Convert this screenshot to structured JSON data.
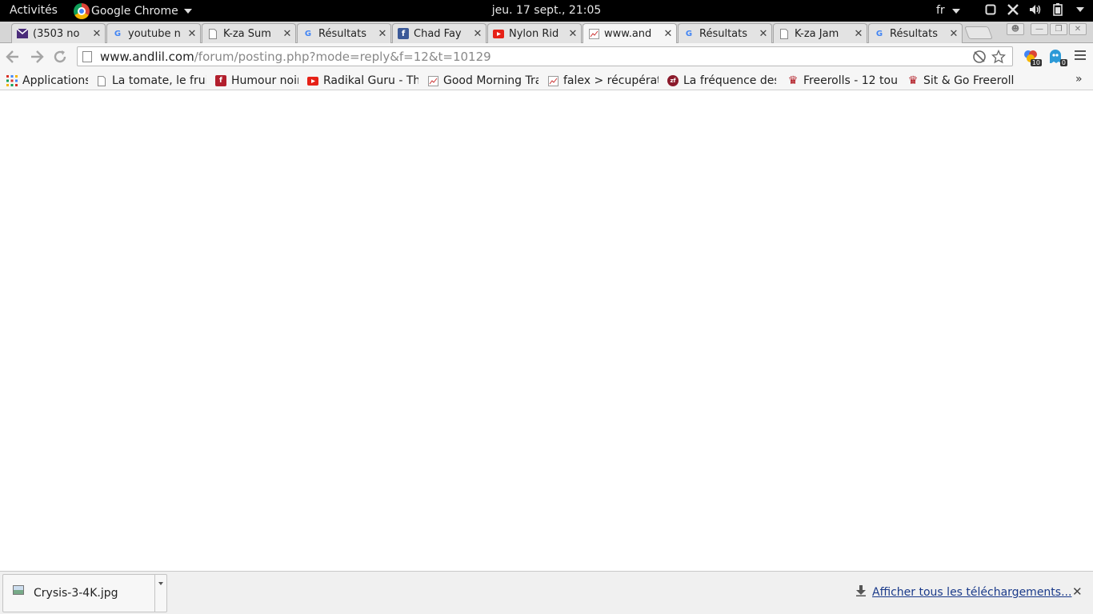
{
  "gnome": {
    "activities": "Activités",
    "app_name": "Google Chrome",
    "clock": "jeu. 17 sept., 21:05",
    "lang": "fr"
  },
  "tabs": [
    {
      "title": "(3503 no",
      "icon": "mail-icon"
    },
    {
      "title": "youtube n",
      "icon": "google-icon"
    },
    {
      "title": "K-za Sum",
      "icon": "page-icon"
    },
    {
      "title": "Résultats",
      "icon": "google-icon"
    },
    {
      "title": "Chad Fay",
      "icon": "facebook-icon"
    },
    {
      "title": "Nylon Rid",
      "icon": "youtube-icon"
    },
    {
      "title": "www.and",
      "icon": "chart-icon"
    },
    {
      "title": "Résultats",
      "icon": "google-icon"
    },
    {
      "title": "K-za Jam",
      "icon": "page-icon"
    },
    {
      "title": "Résultats",
      "icon": "google-icon"
    }
  ],
  "active_tab_index": 6,
  "toolbar": {
    "url_host": "www.andlil.com",
    "url_path": "/forum/posting.php?mode=reply&f=12&t=10129",
    "ext1_badge": "10",
    "ext2_badge": "0"
  },
  "bookmarks": [
    {
      "label": "Applications",
      "icon": "apps-grid-icon"
    },
    {
      "label": "La tomate, le fruit",
      "icon": "page-icon"
    },
    {
      "label": "Humour noir",
      "icon": "ff-icon"
    },
    {
      "label": "Radikal Guru - The",
      "icon": "youtube-icon"
    },
    {
      "label": "Good Morning Tra",
      "icon": "chart-icon"
    },
    {
      "label": "falex > récupérati",
      "icon": "chart-icon"
    },
    {
      "label": "La fréquence des",
      "icon": "zf-icon"
    },
    {
      "label": "Freerolls - 12 tou",
      "icon": "poker-icon"
    },
    {
      "label": "Sit & Go Freeroll",
      "icon": "poker-icon"
    }
  ],
  "download_shelf": {
    "filename": "Crysis-3-4K.jpg",
    "show_all": "Afficher tous les téléchargements..."
  },
  "colors": {
    "topbar": "#000000",
    "link": "#1a3a8a",
    "gmail_red": "#d93025",
    "facebook_blue": "#3b5998",
    "youtube_red": "#e62117"
  }
}
